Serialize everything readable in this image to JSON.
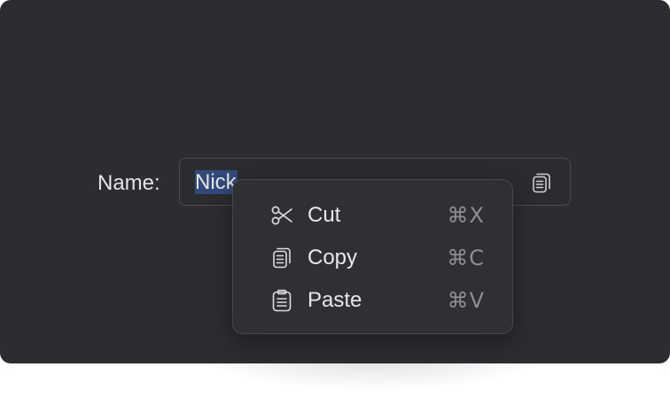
{
  "form": {
    "label": "Name:",
    "value_selected": "Nick",
    "value_rest": ""
  },
  "context_menu": {
    "items": [
      {
        "label": "Cut",
        "shortcut": "⌘X",
        "icon": "scissors-icon"
      },
      {
        "label": "Copy",
        "shortcut": "⌘C",
        "icon": "copy-icon"
      },
      {
        "label": "Paste",
        "shortcut": "⌘V",
        "icon": "clipboard-icon"
      }
    ]
  },
  "colors": {
    "window_background": "#2c2d30",
    "selection": "#33497a",
    "menu_background": "#2f3034",
    "shortcut_text": "#8d8e93"
  }
}
